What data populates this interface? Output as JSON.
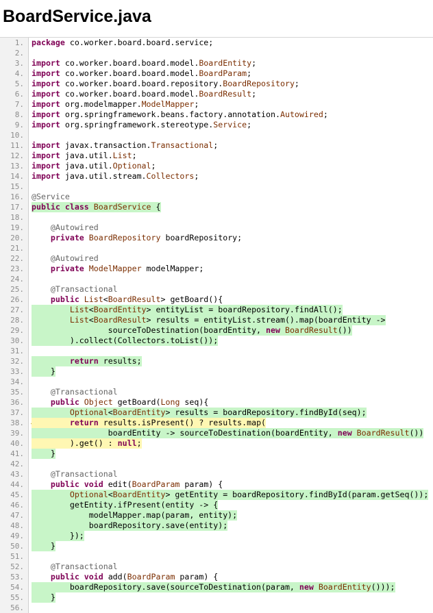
{
  "page": {
    "title": "BoardService.java"
  },
  "code": {
    "lines": [
      {
        "n": "1.",
        "cov": "",
        "segs": [
          [
            "kw",
            "package"
          ],
          [
            "p",
            " co.worker.board.board.service;"
          ]
        ]
      },
      {
        "n": "2.",
        "cov": "",
        "segs": []
      },
      {
        "n": "3.",
        "cov": "",
        "segs": [
          [
            "kw",
            "import"
          ],
          [
            "p",
            " co.worker.board.board.model."
          ],
          [
            "type",
            "BoardEntity"
          ],
          [
            "p",
            ";"
          ]
        ]
      },
      {
        "n": "4.",
        "cov": "",
        "segs": [
          [
            "kw",
            "import"
          ],
          [
            "p",
            " co.worker.board.board.model."
          ],
          [
            "type",
            "BoardParam"
          ],
          [
            "p",
            ";"
          ]
        ]
      },
      {
        "n": "5.",
        "cov": "",
        "segs": [
          [
            "kw",
            "import"
          ],
          [
            "p",
            " co.worker.board.board.repository."
          ],
          [
            "type",
            "BoardRepository"
          ],
          [
            "p",
            ";"
          ]
        ]
      },
      {
        "n": "6.",
        "cov": "",
        "segs": [
          [
            "kw",
            "import"
          ],
          [
            "p",
            " co.worker.board.board.model."
          ],
          [
            "type",
            "BoardResult"
          ],
          [
            "p",
            ";"
          ]
        ]
      },
      {
        "n": "7.",
        "cov": "",
        "segs": [
          [
            "kw",
            "import"
          ],
          [
            "p",
            " org.modelmapper."
          ],
          [
            "type",
            "ModelMapper"
          ],
          [
            "p",
            ";"
          ]
        ]
      },
      {
        "n": "8.",
        "cov": "",
        "segs": [
          [
            "kw",
            "import"
          ],
          [
            "p",
            " org.springframework.beans.factory.annotation."
          ],
          [
            "type",
            "Autowired"
          ],
          [
            "p",
            ";"
          ]
        ]
      },
      {
        "n": "9.",
        "cov": "",
        "segs": [
          [
            "kw",
            "import"
          ],
          [
            "p",
            " org.springframework.stereotype."
          ],
          [
            "type",
            "Service"
          ],
          [
            "p",
            ";"
          ]
        ]
      },
      {
        "n": "10.",
        "cov": "",
        "segs": []
      },
      {
        "n": "11.",
        "cov": "",
        "segs": [
          [
            "kw",
            "import"
          ],
          [
            "p",
            " javax.transaction."
          ],
          [
            "type",
            "Transactional"
          ],
          [
            "p",
            ";"
          ]
        ]
      },
      {
        "n": "12.",
        "cov": "",
        "segs": [
          [
            "kw",
            "import"
          ],
          [
            "p",
            " java.util."
          ],
          [
            "type",
            "List"
          ],
          [
            "p",
            ";"
          ]
        ]
      },
      {
        "n": "13.",
        "cov": "",
        "segs": [
          [
            "kw",
            "import"
          ],
          [
            "p",
            " java.util."
          ],
          [
            "type",
            "Optional"
          ],
          [
            "p",
            ";"
          ]
        ]
      },
      {
        "n": "14.",
        "cov": "",
        "segs": [
          [
            "kw",
            "import"
          ],
          [
            "p",
            " java.util.stream."
          ],
          [
            "type",
            "Collectors"
          ],
          [
            "p",
            ";"
          ]
        ]
      },
      {
        "n": "15.",
        "cov": "",
        "segs": []
      },
      {
        "n": "16.",
        "cov": "",
        "segs": [
          [
            "ann",
            "@Service"
          ]
        ]
      },
      {
        "n": "17.",
        "cov": "full",
        "segs": [
          [
            "kw",
            "public"
          ],
          [
            "p",
            " "
          ],
          [
            "kw",
            "class"
          ],
          [
            "p",
            " "
          ],
          [
            "type",
            "BoardService"
          ],
          [
            "p",
            " {"
          ]
        ]
      },
      {
        "n": "18.",
        "cov": "",
        "segs": []
      },
      {
        "n": "19.",
        "cov": "",
        "segs": [
          [
            "p",
            "    "
          ],
          [
            "ann",
            "@Autowired"
          ]
        ]
      },
      {
        "n": "20.",
        "cov": "",
        "segs": [
          [
            "p",
            "    "
          ],
          [
            "kw",
            "private"
          ],
          [
            "p",
            " "
          ],
          [
            "type",
            "BoardRepository"
          ],
          [
            "p",
            " boardRepository;"
          ]
        ]
      },
      {
        "n": "21.",
        "cov": "",
        "segs": []
      },
      {
        "n": "22.",
        "cov": "",
        "segs": [
          [
            "p",
            "    "
          ],
          [
            "ann",
            "@Autowired"
          ]
        ]
      },
      {
        "n": "23.",
        "cov": "",
        "segs": [
          [
            "p",
            "    "
          ],
          [
            "kw",
            "private"
          ],
          [
            "p",
            " "
          ],
          [
            "type",
            "ModelMapper"
          ],
          [
            "p",
            " modelMapper;"
          ]
        ]
      },
      {
        "n": "24.",
        "cov": "",
        "segs": []
      },
      {
        "n": "25.",
        "cov": "",
        "segs": [
          [
            "p",
            "    "
          ],
          [
            "ann",
            "@Transactional"
          ]
        ]
      },
      {
        "n": "26.",
        "cov": "",
        "segs": [
          [
            "p",
            "    "
          ],
          [
            "kw",
            "public"
          ],
          [
            "p",
            " "
          ],
          [
            "type",
            "List"
          ],
          [
            "p",
            "<"
          ],
          [
            "type",
            "BoardResult"
          ],
          [
            "p",
            "> getBoard(){"
          ]
        ]
      },
      {
        "n": "27.",
        "cov": "full",
        "segs": [
          [
            "p",
            "        "
          ],
          [
            "type",
            "List"
          ],
          [
            "p",
            "<"
          ],
          [
            "type",
            "BoardEntity"
          ],
          [
            "p",
            "> entityList = boardRepository.findAll();"
          ]
        ]
      },
      {
        "n": "28.",
        "cov": "full",
        "segs": [
          [
            "p",
            "        "
          ],
          [
            "type",
            "List"
          ],
          [
            "p",
            "<"
          ],
          [
            "type",
            "BoardResult"
          ],
          [
            "p",
            "> results = entityList.stream().map(boardEntity ->"
          ]
        ]
      },
      {
        "n": "29.",
        "cov": "full",
        "segs": [
          [
            "p",
            "                sourceToDestination(boardEntity, "
          ],
          [
            "kw",
            "new"
          ],
          [
            "p",
            " "
          ],
          [
            "type",
            "BoardResult"
          ],
          [
            "p",
            "())"
          ]
        ]
      },
      {
        "n": "30.",
        "cov": "full",
        "segs": [
          [
            "p",
            "        ).collect(Collectors.toList());"
          ]
        ]
      },
      {
        "n": "31.",
        "cov": "",
        "segs": []
      },
      {
        "n": "32.",
        "cov": "full",
        "segs": [
          [
            "p",
            "        "
          ],
          [
            "kw",
            "return"
          ],
          [
            "p",
            " results;"
          ]
        ]
      },
      {
        "n": "33.",
        "cov": "full",
        "segs": [
          [
            "p",
            "    }"
          ]
        ]
      },
      {
        "n": "34.",
        "cov": "",
        "segs": []
      },
      {
        "n": "35.",
        "cov": "",
        "segs": [
          [
            "p",
            "    "
          ],
          [
            "ann",
            "@Transactional"
          ]
        ]
      },
      {
        "n": "36.",
        "cov": "",
        "segs": [
          [
            "p",
            "    "
          ],
          [
            "kw",
            "public"
          ],
          [
            "p",
            " "
          ],
          [
            "type",
            "Object"
          ],
          [
            "p",
            " getBoard("
          ],
          [
            "type",
            "Long"
          ],
          [
            "p",
            " seq){"
          ]
        ]
      },
      {
        "n": "37.",
        "cov": "full",
        "segs": [
          [
            "p",
            "        "
          ],
          [
            "type",
            "Optional"
          ],
          [
            "p",
            "<"
          ],
          [
            "type",
            "BoardEntity"
          ],
          [
            "p",
            "> results = boardRepository.findById(seq);"
          ]
        ]
      },
      {
        "n": "38.",
        "cov": "part",
        "marker": true,
        "segs": [
          [
            "p",
            "        "
          ],
          [
            "kw",
            "return"
          ],
          [
            "p",
            " results.isPresent() ? results.map("
          ]
        ]
      },
      {
        "n": "39.",
        "cov": "full",
        "segs": [
          [
            "p",
            "                boardEntity -> sourceToDestination(boardEntity, "
          ],
          [
            "kw",
            "new"
          ],
          [
            "p",
            " "
          ],
          [
            "type",
            "BoardResult"
          ],
          [
            "p",
            "())"
          ]
        ]
      },
      {
        "n": "40.",
        "cov": "part",
        "segs": [
          [
            "p",
            "        ).get() : "
          ],
          [
            "kw",
            "null"
          ],
          [
            "p",
            ";"
          ]
        ]
      },
      {
        "n": "41.",
        "cov": "full",
        "segs": [
          [
            "p",
            "    }"
          ]
        ]
      },
      {
        "n": "42.",
        "cov": "",
        "segs": []
      },
      {
        "n": "43.",
        "cov": "",
        "segs": [
          [
            "p",
            "    "
          ],
          [
            "ann",
            "@Transactional"
          ]
        ]
      },
      {
        "n": "44.",
        "cov": "",
        "segs": [
          [
            "p",
            "    "
          ],
          [
            "kw",
            "public"
          ],
          [
            "p",
            " "
          ],
          [
            "kw",
            "void"
          ],
          [
            "p",
            " edit("
          ],
          [
            "type",
            "BoardParam"
          ],
          [
            "p",
            " param) {"
          ]
        ]
      },
      {
        "n": "45.",
        "cov": "full",
        "segs": [
          [
            "p",
            "        "
          ],
          [
            "type",
            "Optional"
          ],
          [
            "p",
            "<"
          ],
          [
            "type",
            "BoardEntity"
          ],
          [
            "p",
            "> getEntity = boardRepository.findById(param.getSeq());"
          ]
        ]
      },
      {
        "n": "46.",
        "cov": "full",
        "segs": [
          [
            "p",
            "        getEntity.ifPresent(entity -> {"
          ]
        ]
      },
      {
        "n": "47.",
        "cov": "full",
        "segs": [
          [
            "p",
            "            modelMapper.map(param, entity);"
          ]
        ]
      },
      {
        "n": "48.",
        "cov": "full",
        "segs": [
          [
            "p",
            "            boardRepository.save(entity);"
          ]
        ]
      },
      {
        "n": "49.",
        "cov": "full",
        "segs": [
          [
            "p",
            "        });"
          ]
        ]
      },
      {
        "n": "50.",
        "cov": "full",
        "segs": [
          [
            "p",
            "    }"
          ]
        ]
      },
      {
        "n": "51.",
        "cov": "",
        "segs": []
      },
      {
        "n": "52.",
        "cov": "",
        "segs": [
          [
            "p",
            "    "
          ],
          [
            "ann",
            "@Transactional"
          ]
        ]
      },
      {
        "n": "53.",
        "cov": "",
        "segs": [
          [
            "p",
            "    "
          ],
          [
            "kw",
            "public"
          ],
          [
            "p",
            " "
          ],
          [
            "kw",
            "void"
          ],
          [
            "p",
            " add("
          ],
          [
            "type",
            "BoardParam"
          ],
          [
            "p",
            " param) {"
          ]
        ]
      },
      {
        "n": "54.",
        "cov": "full",
        "segs": [
          [
            "p",
            "        boardRepository.save(sourceToDestination(param, "
          ],
          [
            "kw",
            "new"
          ],
          [
            "p",
            " "
          ],
          [
            "type",
            "BoardEntity"
          ],
          [
            "p",
            "()));"
          ]
        ]
      },
      {
        "n": "55.",
        "cov": "full",
        "segs": [
          [
            "p",
            "    }"
          ]
        ]
      },
      {
        "n": "56.",
        "cov": "",
        "segs": []
      }
    ]
  }
}
